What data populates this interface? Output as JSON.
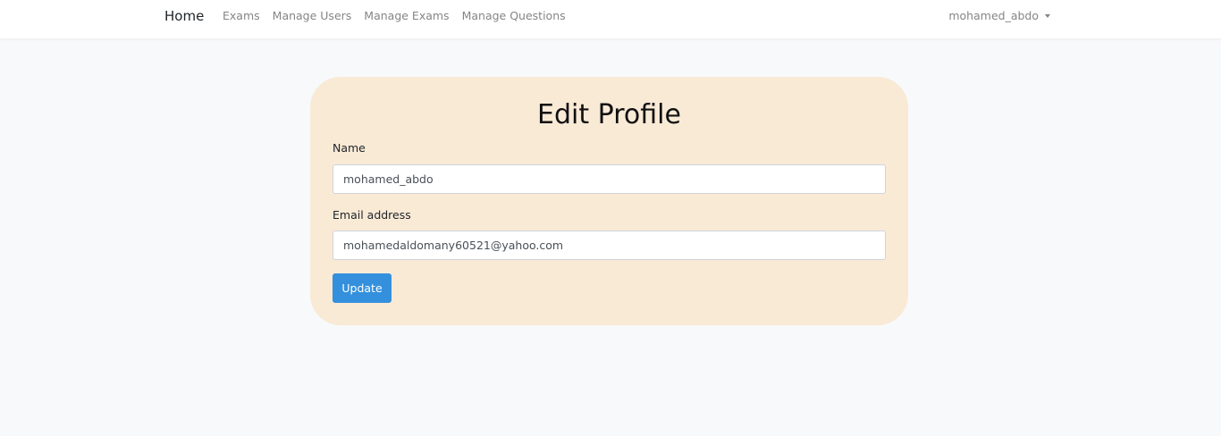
{
  "nav": {
    "brand": "Home",
    "links": [
      "Exams",
      "Manage Users",
      "Manage Exams",
      "Manage Questions"
    ],
    "user": "mohamed_abdo",
    "user_caret_icon": "caret-down-icon"
  },
  "form": {
    "title": "Edit Profile",
    "name_label": "Name",
    "name_value": "mohamed_abdo",
    "email_label": "Email address",
    "email_value": "mohamedaldomany60521@yahoo.com",
    "submit_label": "Update"
  },
  "colors": {
    "page_background": "#f8f9fa",
    "card_background": "#f9ead6",
    "primary_button": "#3490dc",
    "nav_link": "#858585"
  }
}
